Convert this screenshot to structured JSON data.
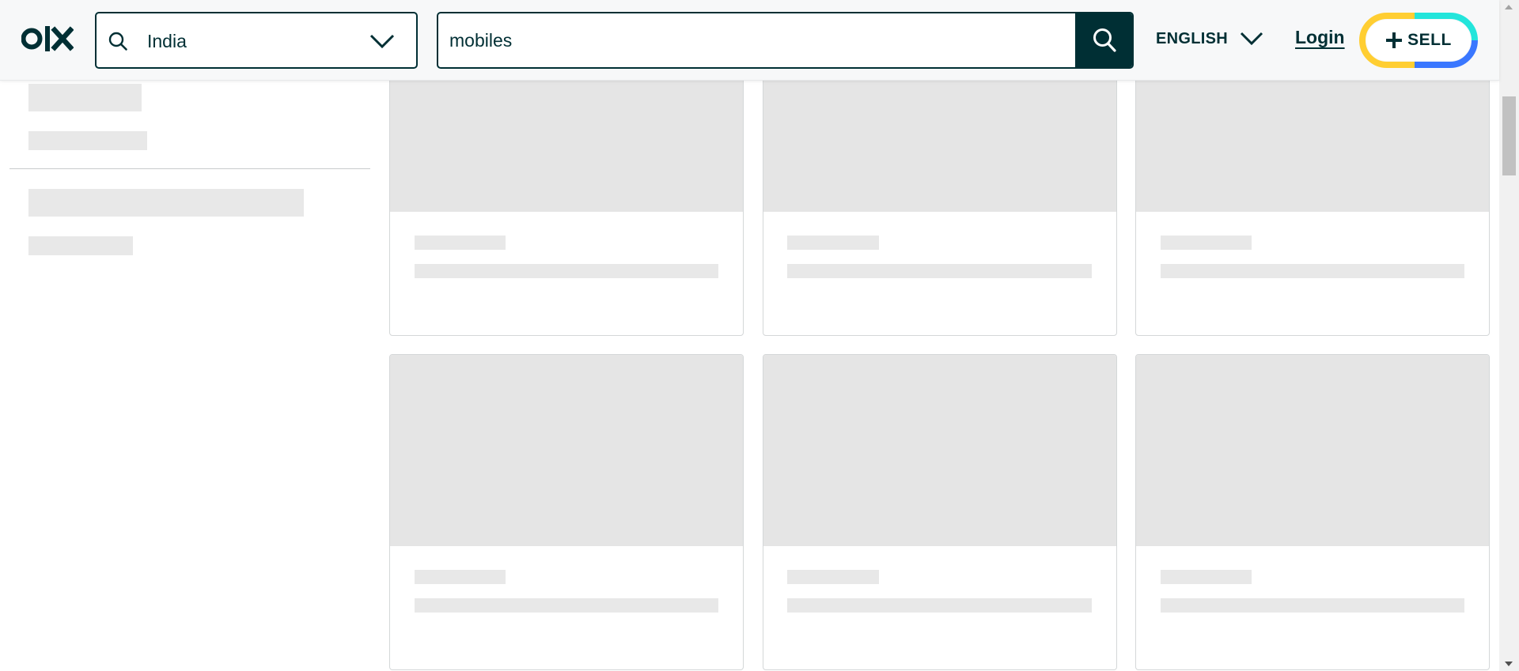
{
  "header": {
    "logo_text": "olx",
    "location": {
      "value": "India",
      "icon": "search-icon",
      "dropdown_icon": "chevron-down-icon"
    },
    "search": {
      "value": "mobiles",
      "button_icon": "search-icon"
    },
    "language": {
      "label": "ENGLISH",
      "icon": "chevron-down-icon"
    },
    "login_label": "Login",
    "sell": {
      "label": "SELL",
      "icon": "plus-icon",
      "ring_colors": [
        "#ffce32",
        "#23e5db",
        "#3a77ff"
      ]
    }
  },
  "colors": {
    "brand_dark": "#002f34",
    "skeleton": "#e8e8e8",
    "skeleton_image": "#e5e5e5",
    "card_border": "#d4d7d8"
  },
  "state": "loading"
}
